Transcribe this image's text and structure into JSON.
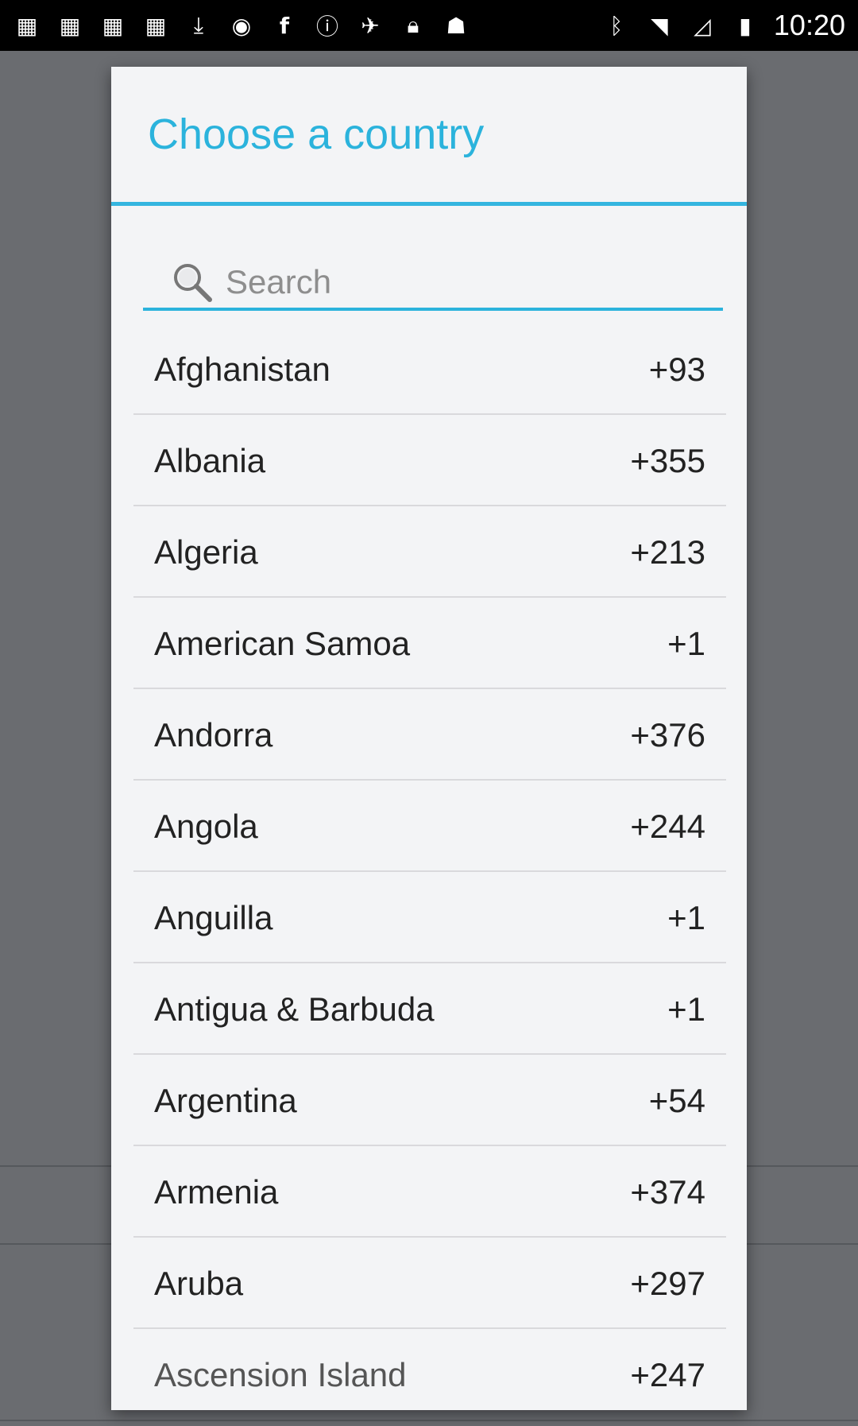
{
  "statusbar": {
    "time": "10:20",
    "icons_left": [
      "grid-icon",
      "grid-icon",
      "grid-icon",
      "grid-icon",
      "download-icon",
      "hotspot-icon",
      "facebook-icon",
      "info-icon",
      "satellite-icon",
      "lock-icon",
      "android-icon"
    ],
    "icons_right": [
      "bluetooth-icon",
      "wifi-icon",
      "no-signal-icon",
      "battery-charging-icon"
    ]
  },
  "modal": {
    "title": "Choose a country",
    "search": {
      "placeholder": "Search",
      "value": ""
    },
    "countries": [
      {
        "name": "Afghanistan",
        "code": "+93"
      },
      {
        "name": "Albania",
        "code": "+355"
      },
      {
        "name": "Algeria",
        "code": "+213"
      },
      {
        "name": "American Samoa",
        "code": "+1"
      },
      {
        "name": "Andorra",
        "code": "+376"
      },
      {
        "name": "Angola",
        "code": "+244"
      },
      {
        "name": "Anguilla",
        "code": "+1"
      },
      {
        "name": "Antigua & Barbuda",
        "code": "+1"
      },
      {
        "name": "Argentina",
        "code": "+54"
      },
      {
        "name": "Armenia",
        "code": "+374"
      },
      {
        "name": "Aruba",
        "code": "+297"
      },
      {
        "name": "Ascension Island",
        "code": "+247"
      }
    ]
  },
  "colors": {
    "accent": "#2bb3dc",
    "modal_bg": "#f3f4f6",
    "backdrop": "#6a6c70"
  }
}
